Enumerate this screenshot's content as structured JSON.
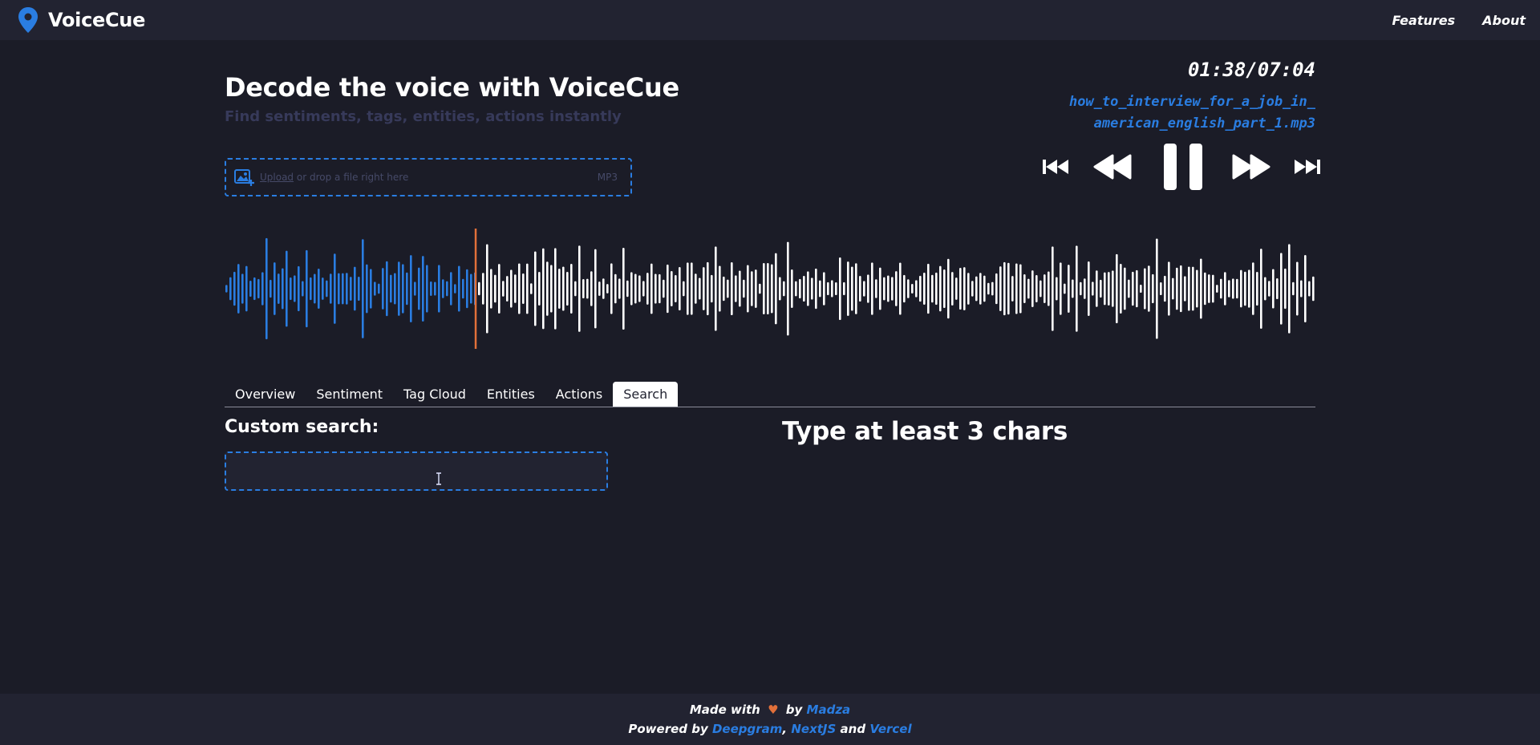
{
  "brand": {
    "name": "VoiceCue"
  },
  "nav": {
    "features": "Features",
    "about": "About"
  },
  "hero": {
    "title": "Decode the voice with VoiceCue",
    "subtitle": "Find sentiments, tags, entities, actions instantly"
  },
  "upload": {
    "link": "Upload",
    "text": "or drop a file right here",
    "type": "MP3"
  },
  "player": {
    "time": "01:38/07:04",
    "filename_line1": "how_to_interview_for_a_job_in_",
    "filename_line2": "american_english_part_1.mp3",
    "progress": 0.23,
    "state": "playing"
  },
  "tabs": [
    {
      "label": "Overview",
      "active": false
    },
    {
      "label": "Sentiment",
      "active": false
    },
    {
      "label": "Tag Cloud",
      "active": false
    },
    {
      "label": "Entities",
      "active": false
    },
    {
      "label": "Actions",
      "active": false
    },
    {
      "label": "Search",
      "active": true
    }
  ],
  "search": {
    "label": "Custom search:",
    "value": "",
    "placeholder": "",
    "message": "Type at least 3 chars"
  },
  "footer": {
    "made_with": "Made with",
    "by": "by",
    "author": "Madza",
    "powered_by": "Powered by",
    "tech1": "Deepgram",
    "comma": ",",
    "tech2": "NextJS",
    "and": "and",
    "tech3": "Vercel"
  },
  "colors": {
    "background": "#1b1c27",
    "bar": "#222331",
    "accent": "#2a7de1",
    "playhead": "#e2703a",
    "muted": "#373a5a"
  }
}
